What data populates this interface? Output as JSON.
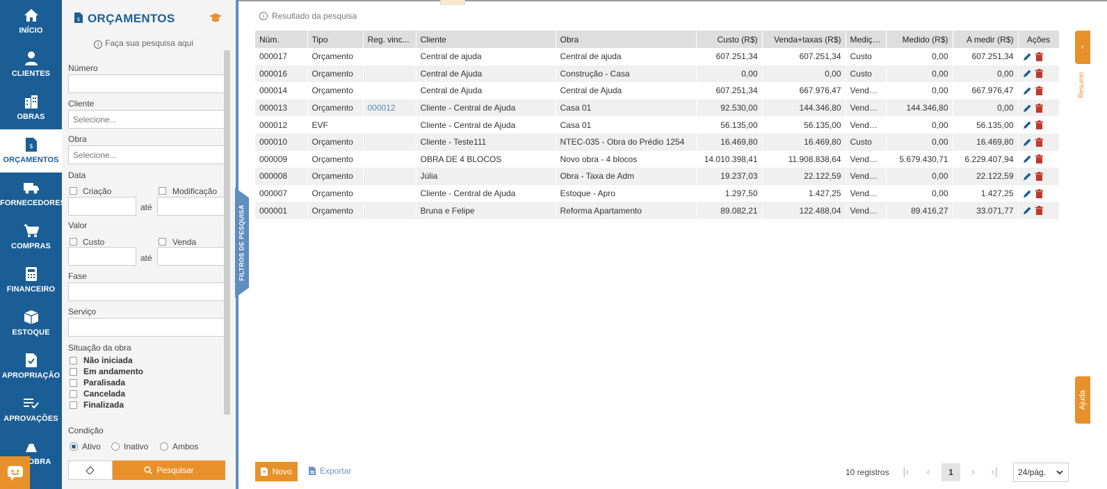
{
  "nav": {
    "items": [
      {
        "label": "INÍCIO",
        "icon": "home-icon"
      },
      {
        "label": "CLIENTES",
        "icon": "user-icon"
      },
      {
        "label": "OBRAS",
        "icon": "buildings-icon"
      },
      {
        "label": "ORÇAMENTOS",
        "icon": "budget-file-icon"
      },
      {
        "label": "FORNECEDORES",
        "icon": "truck-icon"
      },
      {
        "label": "COMPRAS",
        "icon": "cart-icon"
      },
      {
        "label": "FINANCEIRO",
        "icon": "calculator-icon"
      },
      {
        "label": "ESTOQUE",
        "icon": "box-icon"
      },
      {
        "label": "APROPRIAÇÃO",
        "icon": "doc-check-icon"
      },
      {
        "label": "APROVAÇÕES",
        "icon": "list-check-icon"
      },
      {
        "label": "E OBRA",
        "icon": "construction-icon"
      }
    ]
  },
  "filters": {
    "title": "ORÇAMENTOS",
    "hint": "Faça sua pesquisa aqui",
    "numero_label": "Número",
    "cliente_label": "Cliente",
    "cliente_placeholder": "Selecione...",
    "obra_label": "Obra",
    "obra_placeholder": "Selecione...",
    "data_label": "Data",
    "criacao_label": "Criação",
    "modificacao_label": "Modificação",
    "ate": "até",
    "valor_label": "Valor",
    "custo_label": "Custo",
    "venda_label": "Venda",
    "fase_label": "Fase",
    "servico_label": "Serviço",
    "situacao_label": "Situação da obra",
    "situacoes": [
      "Não iniciada",
      "Em andamento",
      "Paralisada",
      "Cancelada",
      "Finalizada"
    ],
    "condicao_label": "Condição",
    "condicoes": [
      "Ativo",
      "Inativo",
      "Ambos"
    ],
    "search_button": "Pesquisar",
    "toggle_label": "FILTROS DE PESQUISA"
  },
  "main": {
    "result_hint": "Resultado da pesquisa",
    "columns": [
      "Núm.",
      "Tipo",
      "Reg. vinc...",
      "Cliente",
      "Obra",
      "Custo (R$)",
      "Venda+taxas (R$)",
      "Medição",
      "Medido (R$)",
      "A medir (R$)",
      "Ações"
    ],
    "rows": [
      [
        "000017",
        "Orçamento",
        "",
        "Central de ajuda",
        "Central de ajuda",
        "607.251,34",
        "607.251,34",
        "Custo",
        "0,00",
        "607.251,34"
      ],
      [
        "000016",
        "Orçamento",
        "",
        "Central de Ajuda",
        "Construção - Casa",
        "0,00",
        "0,00",
        "Custo",
        "0,00",
        "0,00"
      ],
      [
        "000014",
        "Orçamento",
        "",
        "Central de Ajuda",
        "Central de Ajuda",
        "607.251,34",
        "667.976,47",
        "Venda ...",
        "0,00",
        "667.976,47"
      ],
      [
        "000013",
        "Orçamento",
        "000012",
        "Cliente - Central de Ajuda",
        "Casa 01",
        "92.530,00",
        "144.346,80",
        "Venda ...",
        "144.346,80",
        "0,00"
      ],
      [
        "000012",
        "EVF",
        "",
        "Cliente - Central de Ajuda",
        "Casa 01",
        "56.135,00",
        "56.135,00",
        "Venda ...",
        "0,00",
        "56.135,00"
      ],
      [
        "000010",
        "Orçamento",
        "",
        "Cliente - Teste111",
        "NTEC-035 - Obra do Prédio 1254",
        "16.469,80",
        "16.469,80",
        "Custo",
        "0,00",
        "16.469,80"
      ],
      [
        "000009",
        "Orçamento",
        "",
        "OBRA DE 4 BLOCOS",
        "Novo obra - 4 blocos",
        "14.010.398,41",
        "11.908.838,64",
        "Venda ...",
        "5.679.430,71",
        "6.229.407,94"
      ],
      [
        "000008",
        "Orçamento",
        "",
        "Júlia",
        "Obra - Taxa de Adm",
        "19.237,03",
        "22.122,59",
        "Venda ...",
        "0,00",
        "22.122,59"
      ],
      [
        "000007",
        "Orçamento",
        "",
        "Cliente - Central de Ajuda",
        "Estoque - Apro",
        "1.297,50",
        "1.427,25",
        "Venda ...",
        "0,00",
        "1.427,25"
      ],
      [
        "000001",
        "Orçamento",
        "",
        "Bruna e Felipe",
        "Reforma Apartamento",
        "89.082,21",
        "122.488,04",
        "Venda ...",
        "89.416,27",
        "33.071,77"
      ]
    ],
    "resumo_label": "Resumo",
    "ajuda_label": "Ajuda"
  },
  "footer": {
    "novo_button": "Novo",
    "export_button": "Exportar",
    "records": "10 registros",
    "current_page": "1",
    "per_page": "24/pág."
  },
  "colors": {
    "nav_bg": "#1b5e96",
    "accent": "#e8912b",
    "delete": "#c0392b",
    "edit": "#1b5e96",
    "link": "#5a8bbd"
  }
}
